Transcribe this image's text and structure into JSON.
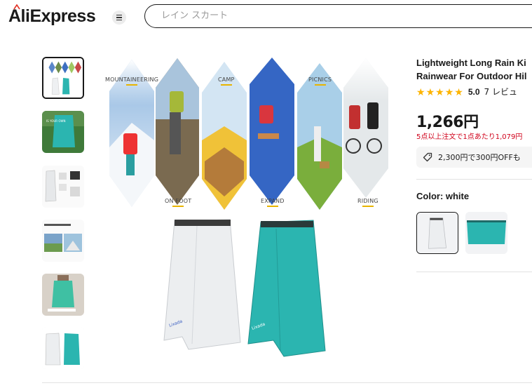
{
  "header": {
    "logo_text": "AliExpress",
    "menu_icon": "hamburger-icon",
    "search_placeholder": "レイン スカート"
  },
  "gallery": {
    "thumbnails": [
      {
        "subject": "activities-collage",
        "selected": true
      },
      {
        "subject": "teal-skirt-outdoor",
        "selected": false
      },
      {
        "subject": "white-skirt-detail",
        "selected": false
      },
      {
        "subject": "waterproof-rain-skirt-info",
        "selected": false
      },
      {
        "subject": "teal-skirt-worn",
        "selected": false
      },
      {
        "subject": "white-and-teal-skirts",
        "selected": false
      }
    ],
    "main_image": {
      "labels": [
        "MOUNTAINEERING",
        "CAMP",
        "PICNICS",
        "ON FOOT",
        "EXPAND",
        "RIDING"
      ]
    }
  },
  "product": {
    "title_line1": "Lightweight Long Rain Ki",
    "title_line2": "Rainwear For Outdoor Hil",
    "rating_score": "5.0",
    "rating_count": "7 レビュ",
    "stars": 5,
    "price": "1,266円",
    "bulk_note": "5点以上注文で1点あたり1,079円",
    "coupon_text": "2,300円で300円OFFも",
    "coupon_icon": "tag-icon",
    "color_label": "Color: white",
    "colors": [
      {
        "name": "white",
        "hex": "#eef0f2",
        "selected": true
      },
      {
        "name": "teal",
        "hex": "#2bb5b0",
        "selected": false
      }
    ]
  },
  "theme": {
    "accent_red": "#d0021b",
    "star_color": "#fdb400",
    "label_underline": "#e8b400"
  }
}
